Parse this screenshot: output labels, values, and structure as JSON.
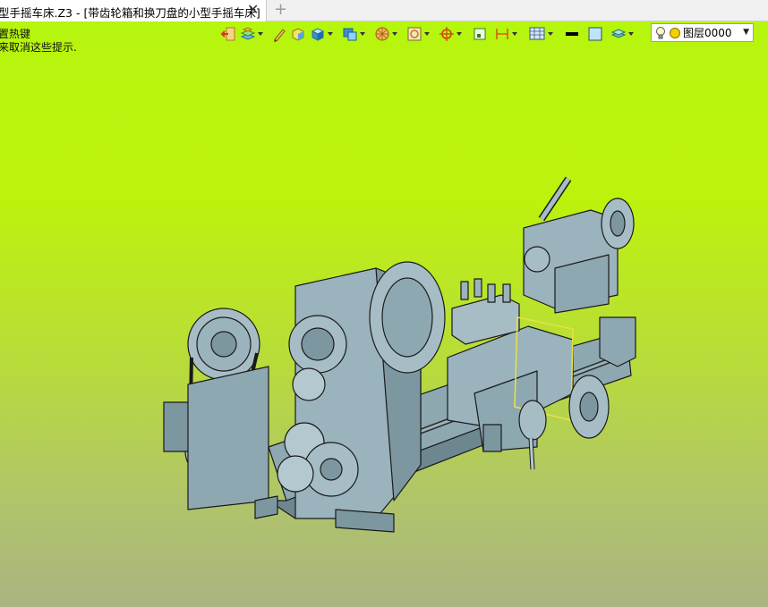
{
  "tab": {
    "title": "型手摇车床.Z3 - [带齿轮箱和换刀盘的小型手摇车床]",
    "close_glyph": "✕",
    "new_glyph": "+"
  },
  "hints": {
    "line1": "置热键",
    "line2": "来取消这些提示."
  },
  "toolbar": {
    "icons": [
      "exit-icon",
      "layer-stack-icon",
      "pencil-icon",
      "shaded-solid-icon",
      "solid-box-icon",
      "display-mode-icon",
      "render-sphere-icon",
      "zoom-window-icon",
      "target-icon",
      "line-style-icon",
      "dimension-icon",
      "grid-icon",
      "line-color-icon",
      "fill-color-icon",
      "layer-manager-icon"
    ]
  },
  "layer": {
    "label": "图层0000"
  },
  "colors": {
    "model": "#9ab3bd",
    "model_dark": "#6d8791",
    "outline": "#1a1a1a",
    "highlight": "#e6e04a"
  }
}
